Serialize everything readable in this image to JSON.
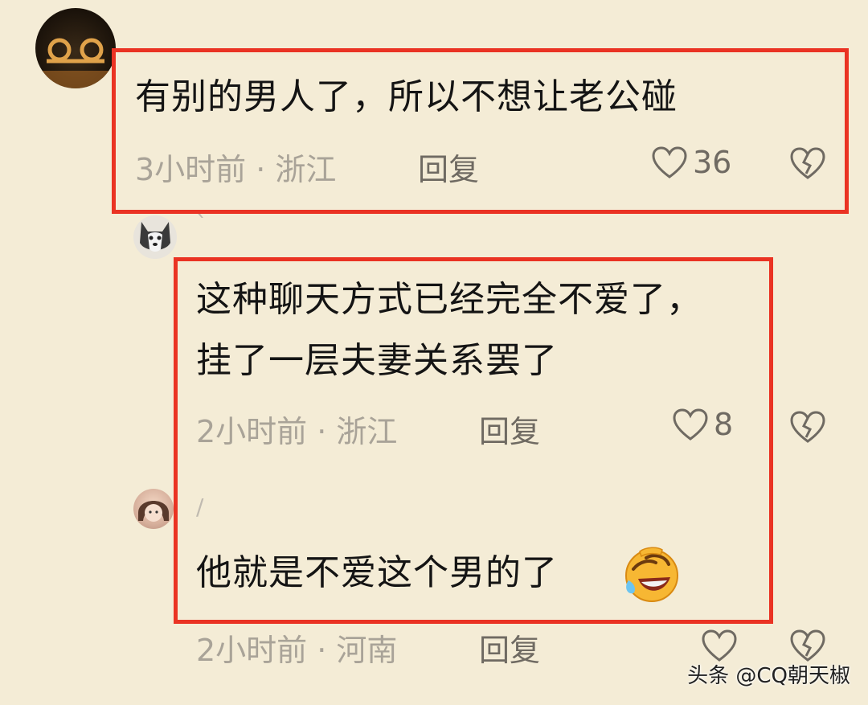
{
  "comments": [
    {
      "text": "有别的男人了，所以不想让老公碰",
      "time_location": "3小时前 · 浙江",
      "reply_label": "回复",
      "likes": "36",
      "username": ""
    },
    {
      "text_lines": [
        "这种聊天方式已经完全不爱了，",
        "挂了一层夫妻关系罢了"
      ],
      "time_location": "2小时前 · 浙江",
      "reply_label": "回复",
      "likes": "8",
      "username": "`"
    },
    {
      "text": "他就是不爱这个男的了",
      "time_location": "2小时前 · 河南",
      "reply_label": "回复",
      "likes": "",
      "username": "/"
    }
  ],
  "emoji": "rolling-on-floor-laughing-emoji",
  "watermark": "头条 @CQ朝天椒",
  "colors": {
    "background": "#f4ecd6",
    "highlight": "#ea3323",
    "meta_text": "#a9a398",
    "icon": "#6f6a62"
  }
}
